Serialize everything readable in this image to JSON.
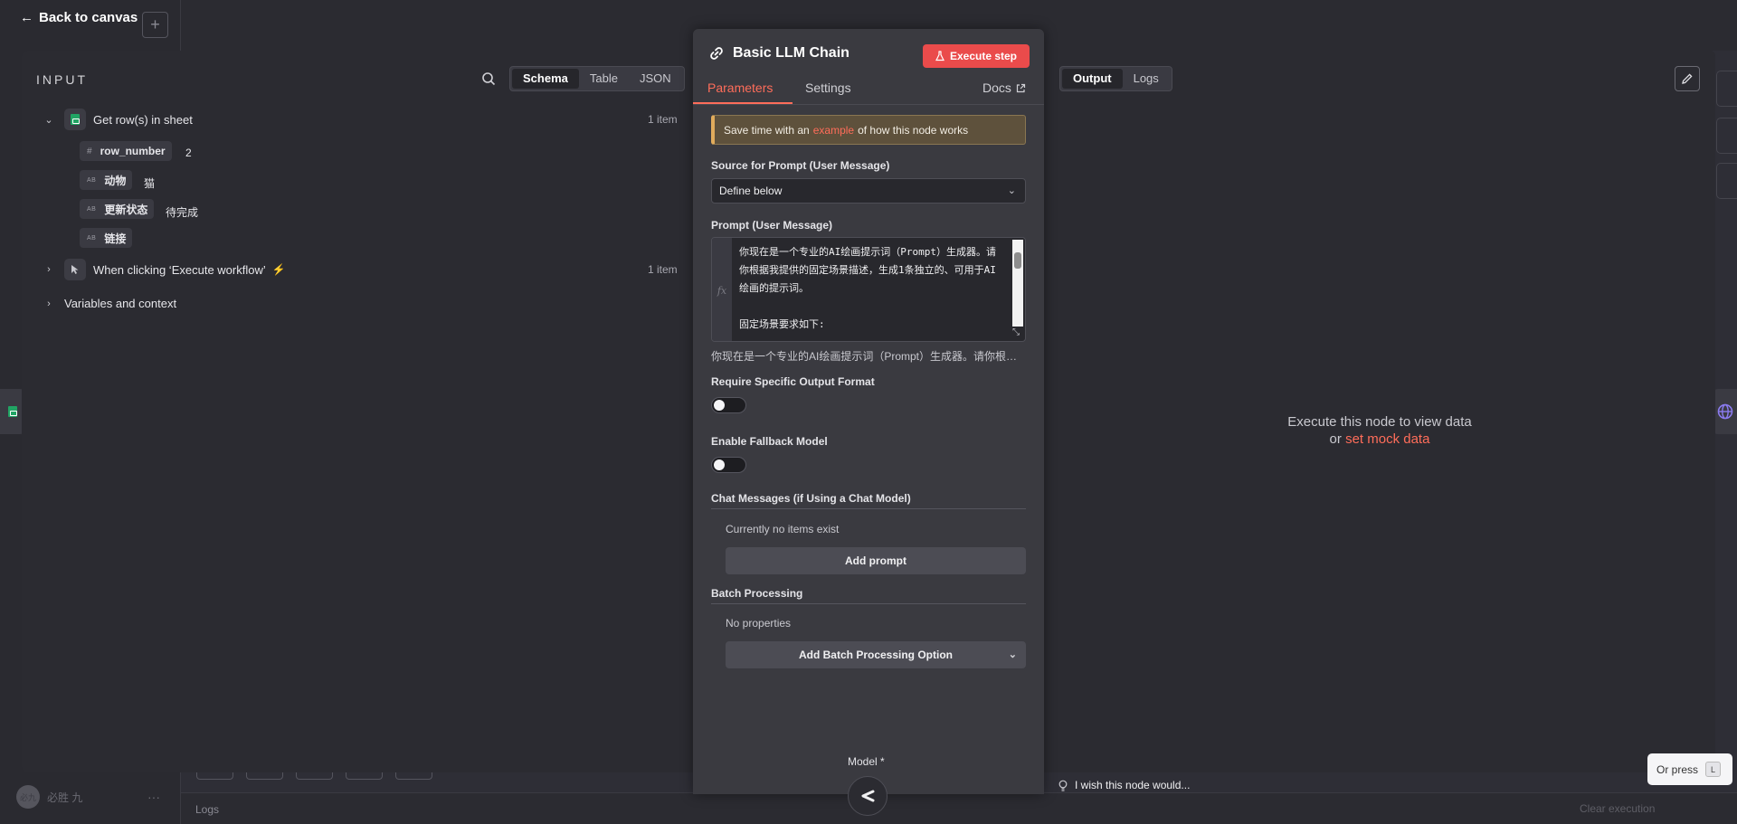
{
  "canvas": {
    "back_label": "Back to canvas",
    "plus_label": "+",
    "user_initials": "必九",
    "user_name": "必胜 九",
    "menu_dots": "···",
    "logs_label": "Logs",
    "clear_label": "Clear execution"
  },
  "input_panel": {
    "title": "INPUT",
    "view_tabs": [
      "Schema",
      "Table",
      "JSON"
    ],
    "nodes": [
      {
        "name": "Get row(s) in sheet",
        "count": "1 item",
        "fields": [
          {
            "type": "#",
            "name": "row_number",
            "value": "2"
          },
          {
            "type": "AB",
            "name": "动物",
            "value": "猫"
          },
          {
            "type": "AB",
            "name": "更新状态",
            "value": "待完成"
          },
          {
            "type": "AB",
            "name": "链接",
            "value": ""
          }
        ]
      },
      {
        "name": "When clicking ‘Execute workflow’",
        "count": "1 item"
      }
    ],
    "variables_label": "Variables and context"
  },
  "node_panel": {
    "title": "Basic LLM Chain",
    "execute_label": "Execute step",
    "tabs": [
      "Parameters",
      "Settings"
    ],
    "docs_label": "Docs",
    "notice": {
      "prefix": "Save time with an",
      "link": "example",
      "suffix": "of how this node works"
    },
    "source_label": "Source for Prompt (User Message)",
    "source_value": "Define below",
    "prompt_label": "Prompt (User Message)",
    "prompt_gutter": "fx",
    "prompt_text": "你现在是一个专业的AI绘画提示词（Prompt）生成器。请你根据我提供的固定场景描述，生成1条独立的、可用于AI绘画的提示词。\n\n固定场景要求如下:",
    "prompt_preview": "你现在是一个专业的AI绘画提示词（Prompt）生成器。请你根据我提供的固定场景描述，生成1条独立的、可用于AI绘画的提示词。",
    "require_format_label": "Require Specific Output Format",
    "require_format_on": false,
    "fallback_label": "Enable Fallback Model",
    "fallback_on": false,
    "chat_section": "Chat Messages (if Using a Chat Model)",
    "chat_empty": "Currently no items exist",
    "add_prompt_label": "Add prompt",
    "batch_section": "Batch Processing",
    "batch_empty": "No properties",
    "add_batch_label": "Add Batch Processing Option",
    "model_label": "Model *"
  },
  "output_panel": {
    "tabs": [
      "Output",
      "Logs"
    ],
    "message_line1": "Execute this node to view data",
    "message_or": "or",
    "message_link": "set mock data"
  },
  "feedback": {
    "wish_label": "I wish this node would...",
    "or_press_label": "Or press",
    "key_label": "L"
  },
  "colors": {
    "accent": "#ff6d5a",
    "execute_button": "#ea4b4b",
    "sheets_green": "#21a464",
    "notice_bg": "#5e513c"
  }
}
